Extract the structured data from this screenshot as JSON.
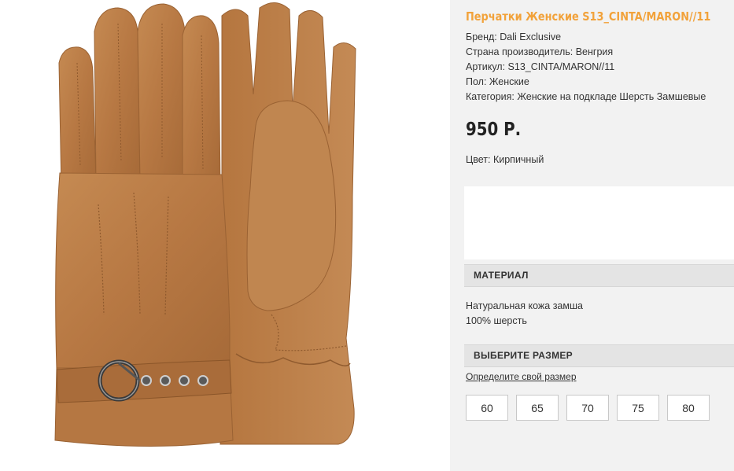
{
  "product": {
    "title": "Перчатки Женские S13_CINTA/MARON//11",
    "image_alt": "glove-photo",
    "specs": [
      "Бренд: Dali Exclusive",
      "Страна производитель: Венгрия",
      "Артикул: S13_CINTA/MARON//11",
      "Пол: Женские",
      "Категория: Женские на подкладе Шерсть Замшевые"
    ],
    "price": "950 Р.",
    "color": "Цвет: Кирпичный"
  },
  "material": {
    "header": "МАТЕРИАЛ",
    "lines": [
      "Натуральная кожа замша",
      "100% шерсть"
    ]
  },
  "sizes": {
    "header": "ВЫБЕРИТЕ РАЗМЕР",
    "guide_link": "Определите свой размер",
    "options": [
      "60",
      "65",
      "70",
      "75",
      "80"
    ]
  },
  "colors": {
    "title": "#f2a23a",
    "suede": "#b97a45",
    "panel_bg": "#f2f2f2",
    "header_bg": "#e4e4e4"
  }
}
